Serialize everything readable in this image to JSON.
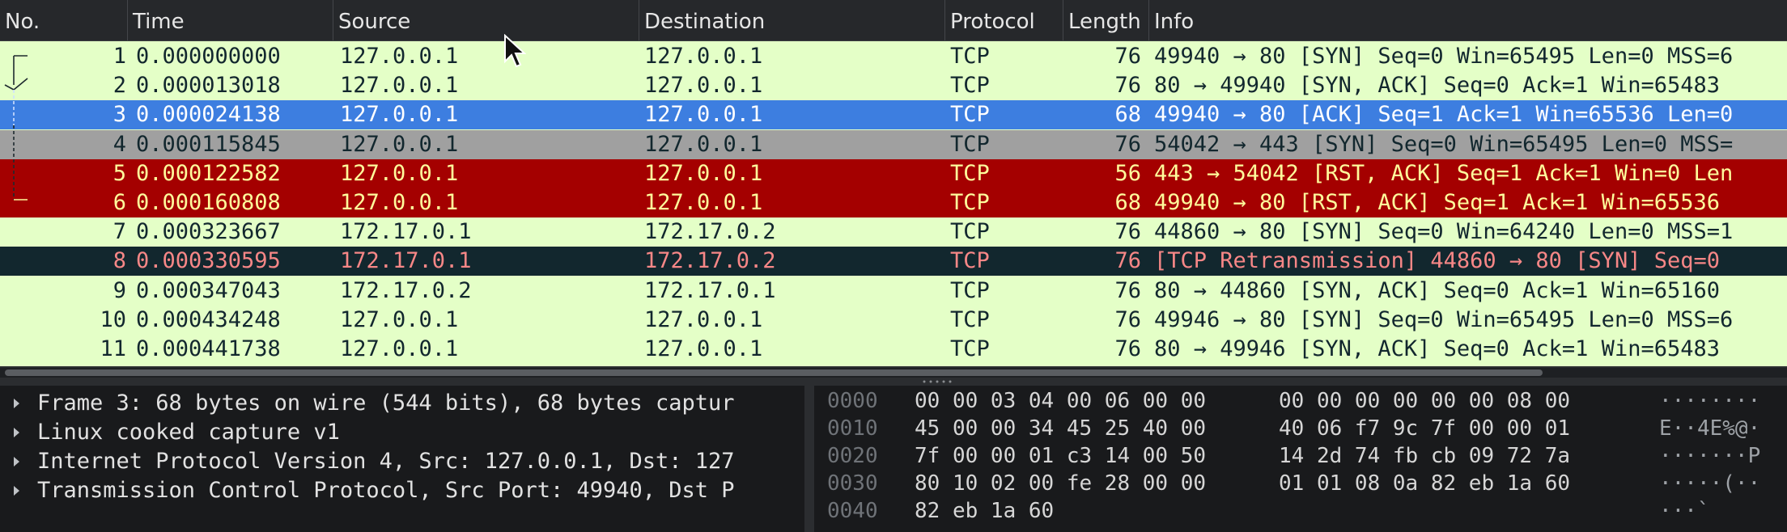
{
  "columns": [
    {
      "key": "no",
      "label": "No."
    },
    {
      "key": "time",
      "label": "Time"
    },
    {
      "key": "source",
      "label": "Source"
    },
    {
      "key": "destination",
      "label": "Destination"
    },
    {
      "key": "protocol",
      "label": "Protocol"
    },
    {
      "key": "length",
      "label": "Length"
    },
    {
      "key": "info",
      "label": "Info"
    }
  ],
  "packets": [
    {
      "no": "1",
      "time": "0.000000000",
      "source": "127.0.0.1",
      "destination": "127.0.0.1",
      "protocol": "TCP",
      "length": "76",
      "info": "49940 → 80 [SYN] Seq=0 Win=65495 Len=0 MSS=6",
      "style": "tcp"
    },
    {
      "no": "2",
      "time": "0.000013018",
      "source": "127.0.0.1",
      "destination": "127.0.0.1",
      "protocol": "TCP",
      "length": "76",
      "info": "80 → 49940 [SYN, ACK] Seq=0 Ack=1 Win=65483",
      "style": "tcp"
    },
    {
      "no": "3",
      "time": "0.000024138",
      "source": "127.0.0.1",
      "destination": "127.0.0.1",
      "protocol": "TCP",
      "length": "68",
      "info": "49940 → 80 [ACK] Seq=1 Ack=1 Win=65536 Len=0",
      "style": "selected"
    },
    {
      "no": "4",
      "time": "0.000115845",
      "source": "127.0.0.1",
      "destination": "127.0.0.1",
      "protocol": "TCP",
      "length": "76",
      "info": "54042 → 443 [SYN] Seq=0 Win=65495 Len=0 MSS=",
      "style": "gray"
    },
    {
      "no": "5",
      "time": "0.000122582",
      "source": "127.0.0.1",
      "destination": "127.0.0.1",
      "protocol": "TCP",
      "length": "56",
      "info": "443 → 54042 [RST, ACK] Seq=1 Ack=1 Win=0 Len",
      "style": "red"
    },
    {
      "no": "6",
      "time": "0.000160808",
      "source": "127.0.0.1",
      "destination": "127.0.0.1",
      "protocol": "TCP",
      "length": "68",
      "info": "49940 → 80 [RST, ACK] Seq=1 Ack=1 Win=65536",
      "style": "red"
    },
    {
      "no": "7",
      "time": "0.000323667",
      "source": "172.17.0.1",
      "destination": "172.17.0.2",
      "protocol": "TCP",
      "length": "76",
      "info": "44860 → 80 [SYN] Seq=0 Win=64240 Len=0 MSS=1",
      "style": "tcp"
    },
    {
      "no": "8",
      "time": "0.000330595",
      "source": "172.17.0.1",
      "destination": "172.17.0.2",
      "protocol": "TCP",
      "length": "76",
      "info": "[TCP Retransmission] 44860 → 80 [SYN] Seq=0",
      "style": "dark"
    },
    {
      "no": "9",
      "time": "0.000347043",
      "source": "172.17.0.2",
      "destination": "172.17.0.1",
      "protocol": "TCP",
      "length": "76",
      "info": "80 → 44860 [SYN, ACK] Seq=0 Ack=1 Win=65160",
      "style": "tcp"
    },
    {
      "no": "10",
      "time": "0.000434248",
      "source": "127.0.0.1",
      "destination": "127.0.0.1",
      "protocol": "TCP",
      "length": "76",
      "info": "49946 → 80 [SYN] Seq=0 Win=65495 Len=0 MSS=6",
      "style": "tcp"
    },
    {
      "no": "11",
      "time": "0.000441738",
      "source": "127.0.0.1",
      "destination": "127.0.0.1",
      "protocol": "TCP",
      "length": "76",
      "info": "80 → 49946 [SYN, ACK] Seq=0 Ack=1 Win=65483",
      "style": "tcp"
    }
  ],
  "details": [
    "Frame 3: 68 bytes on wire (544 bits), 68 bytes captur",
    "Linux cooked capture v1",
    "Internet Protocol Version 4, Src: 127.0.0.1, Dst: 127",
    "Transmission Control Protocol, Src Port: 49940, Dst P"
  ],
  "hex": [
    {
      "offset": "0000",
      "bytes1": "00 00 03 04 00 06 00 00",
      "bytes2": "00 00 00 00 00 00 08 00",
      "ascii": "········"
    },
    {
      "offset": "0010",
      "bytes1": "45 00 00 34 45 25 40 00",
      "bytes2": "40 06 f7 9c 7f 00 00 01",
      "ascii": "E··4E%@·"
    },
    {
      "offset": "0020",
      "bytes1": "7f 00 00 01 c3 14 00 50",
      "bytes2": "14 2d 74 fb cb 09 72 7a",
      "ascii": "·······P"
    },
    {
      "offset": "0030",
      "bytes1": "80 10 02 00 fe 28 00 00",
      "bytes2": "01 01 08 0a 82 eb 1a 60",
      "ascii": "·····(··"
    },
    {
      "offset": "0040",
      "bytes1": "82 eb 1a 60",
      "bytes2": "",
      "ascii": "···`"
    }
  ],
  "colors": {
    "tcp": "#e4ffc7",
    "selected": "#3d7ee0",
    "gray": "#a0a0a0",
    "red": "#a40000",
    "dark": "#12272e"
  }
}
